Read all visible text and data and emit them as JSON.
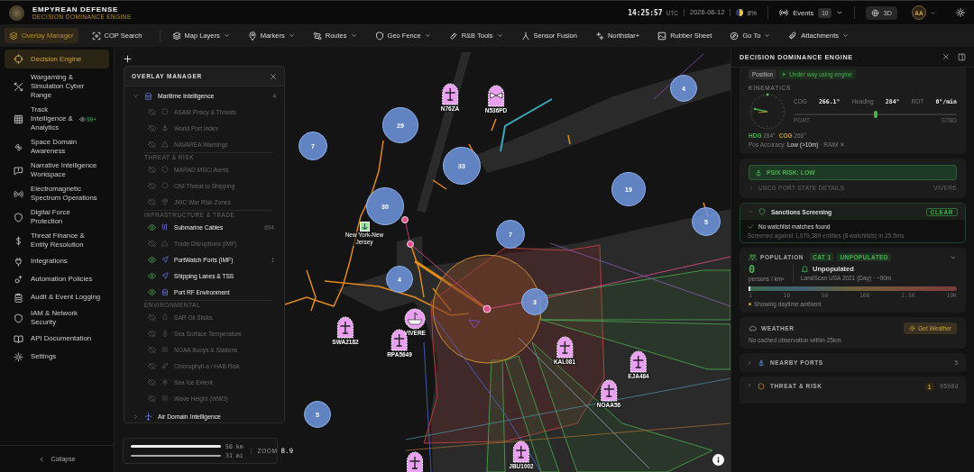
{
  "app": {
    "title": "EMPYREAN DEFENSE",
    "subtitle": "DECISION DOMINANCE ENGINE"
  },
  "status": {
    "time": "14:25:57",
    "time_zone": "UTC",
    "date": "2026-06-12",
    "moon": "8%",
    "events_label": "Events",
    "events_count": "10",
    "view_mode": "3D",
    "avatar": "AA"
  },
  "toolbar": {
    "primary": [
      {
        "label": "Overlay Manager",
        "selected": true,
        "dropdown": false
      },
      {
        "label": "COP Search",
        "selected": false,
        "dropdown": false
      }
    ],
    "tools": [
      {
        "label": "Map Layers",
        "dropdown": true
      },
      {
        "label": "Markers",
        "dropdown": true
      },
      {
        "label": "Routes",
        "dropdown": true
      },
      {
        "label": "Geo Fence",
        "dropdown": true
      },
      {
        "label": "R&B Tools",
        "dropdown": true
      },
      {
        "label": "Sensor Fusion",
        "dropdown": false
      },
      {
        "label": "Northstar+",
        "dropdown": false
      },
      {
        "label": "Rubber Sheet",
        "dropdown": false
      },
      {
        "label": "Go To",
        "dropdown": true
      },
      {
        "label": "Attachments",
        "dropdown": true
      }
    ]
  },
  "sidebar": {
    "items": [
      {
        "label": "Decision Engine",
        "selected": true
      },
      {
        "label": "Wargaming & Simulation Cyber Range",
        "selected": false
      },
      {
        "label": "Track Intelligence & Analytics",
        "selected": false,
        "badge": "99+"
      },
      {
        "label": "Space Domain Awareness",
        "selected": false
      },
      {
        "label": "Narrative Intelligence Workspace",
        "selected": false
      },
      {
        "label": "Electromagnetic Spectrum Operations",
        "selected": false
      },
      {
        "label": "Digital Force Protection",
        "selected": false
      },
      {
        "label": "Threat Finance & Entity Resolution",
        "selected": false
      },
      {
        "label": "Integrations",
        "selected": false
      },
      {
        "label": "Automation Policies",
        "selected": false
      },
      {
        "label": "Audit & Event Logging",
        "selected": false
      },
      {
        "label": "IAM & Network Security",
        "selected": false
      },
      {
        "label": "API Documentation",
        "selected": false
      },
      {
        "label": "Settings",
        "selected": false
      }
    ],
    "collapse": "Collapse"
  },
  "overlay_manager": {
    "title": "OVERLAY MANAGER",
    "groups": [
      {
        "name": "Maritime Intelligence",
        "count": "4",
        "expanded": true,
        "sections": [
          {
            "layers": [
              {
                "name": "ASAM Piracy & Threats",
                "visible": false
              },
              {
                "name": "World Port Index",
                "visible": false
              },
              {
                "name": "NAVAREA Warnings",
                "visible": false
              }
            ]
          },
          {
            "title": "THREAT & RISK",
            "layers": [
              {
                "name": "MARAD MSCI Alerts",
                "visible": false
              },
              {
                "name": "ONI Threat to Shipping",
                "visible": false
              },
              {
                "name": "JWC War Risk Zones",
                "visible": false
              }
            ]
          },
          {
            "title": "INFRASTRUCTURE & TRADE",
            "layers": [
              {
                "name": "Submarine Cables",
                "visible": true,
                "count": "694"
              },
              {
                "name": "Trade Disruptions (IMF)",
                "visible": false
              },
              {
                "name": "PortWatch Ports (IMF)",
                "visible": true,
                "count": "1"
              },
              {
                "name": "Shipping Lanes & TSS",
                "visible": true
              },
              {
                "name": "Port RF Environment",
                "visible": true
              }
            ]
          },
          {
            "title": "ENVIRONMENTAL",
            "layers": [
              {
                "name": "SAR Oil Slicks",
                "visible": false
              },
              {
                "name": "Sea Surface Temperature",
                "visible": false
              },
              {
                "name": "NOAA Buoys & Stations",
                "visible": false
              },
              {
                "name": "Chlorophyll-a / HAB Risk",
                "visible": false
              },
              {
                "name": "Sea Ice Extent",
                "visible": false
              },
              {
                "name": "Wave Height (WW3)",
                "visible": false
              }
            ]
          }
        ]
      },
      {
        "name": "Air Domain Intelligence",
        "expanded": false
      }
    ]
  },
  "map": {
    "clusters": [
      {
        "count": "4"
      },
      {
        "count": "29"
      },
      {
        "count": "7"
      },
      {
        "count": "33"
      },
      {
        "count": "19"
      },
      {
        "count": "30"
      },
      {
        "count": "5"
      },
      {
        "count": "7"
      },
      {
        "count": "4"
      },
      {
        "count": "3"
      },
      {
        "count": "5"
      }
    ],
    "markers": [
      {
        "kind": "aircraft",
        "label": "N76ZA"
      },
      {
        "kind": "unknown",
        "label": "N536PD"
      },
      {
        "kind": "port",
        "label": "New York-New Jersey"
      },
      {
        "kind": "aircraft",
        "label": "SWA2182"
      },
      {
        "kind": "vessel",
        "label": "VIVERE"
      },
      {
        "kind": "aircraft",
        "label": "RPA5649"
      },
      {
        "kind": "aircraft",
        "label": "KAL081"
      },
      {
        "kind": "aircraft",
        "label": "EJA484"
      },
      {
        "kind": "aircraft",
        "label": "NOAA56"
      },
      {
        "kind": "aircraft",
        "label": "JBU1002"
      },
      {
        "kind": "aircraft"
      }
    ],
    "scale": {
      "km": "50 km",
      "mi": "31 mi"
    },
    "zoom_label": "ZOOM",
    "zoom": "8.9"
  },
  "detail_panel": {
    "title": "DECISION DOMINANCE ENGINE",
    "position_label": "Position",
    "nav_status": "Under way using engine",
    "kinematics": {
      "title": "KINEMATICS",
      "readings": [
        {
          "label": "COG",
          "value": "266.1°"
        },
        {
          "label": "Heading",
          "value": "284°"
        },
        {
          "label": "ROT",
          "value": "0°/min"
        }
      ],
      "rot_slider": {
        "level": 0.5,
        "left": "PORT",
        "right": "STBD"
      },
      "hdg_label": "HDG",
      "hdg": "284°",
      "cog_label": "COG",
      "cog": "266°",
      "accuracy": "Pos Accuracy: **Low (>10m)** · RAIM ✕"
    },
    "psix": {
      "label": "PSIX RISK: LOW",
      "details": "USCG PORT STATE DETAILS",
      "vessel": "VIVERE"
    },
    "sanctions": {
      "title": "Sanctions Screening",
      "status": "CLEAR",
      "result": "No watchlist matches found",
      "note": "Screened against 1,079,389 entities (8 watchlists) in 25.5ms"
    },
    "population": {
      "title": "POPULATION",
      "badges": [
        "CAT 1",
        "UNPOPULATED"
      ],
      "density": "0",
      "unit": "persons / km²",
      "class": "Unpopulated",
      "source": "LandScan USA 2021 (Day) · ~90m",
      "scale": {
        "level": 0,
        "ticks": [
          "1",
          "10",
          "50",
          "100",
          "2.5K",
          "10K"
        ]
      },
      "note": "Showing daytime ambient"
    },
    "weather": {
      "title": "WEATHER",
      "button": "Get Weather",
      "note": "No cached observation within 25km"
    },
    "nearby_ports": {
      "title": "NEARBY PORTS",
      "count": "5"
    },
    "threat": {
      "title": "THREAT & RISK",
      "count": "1",
      "age": "9598d"
    }
  }
}
